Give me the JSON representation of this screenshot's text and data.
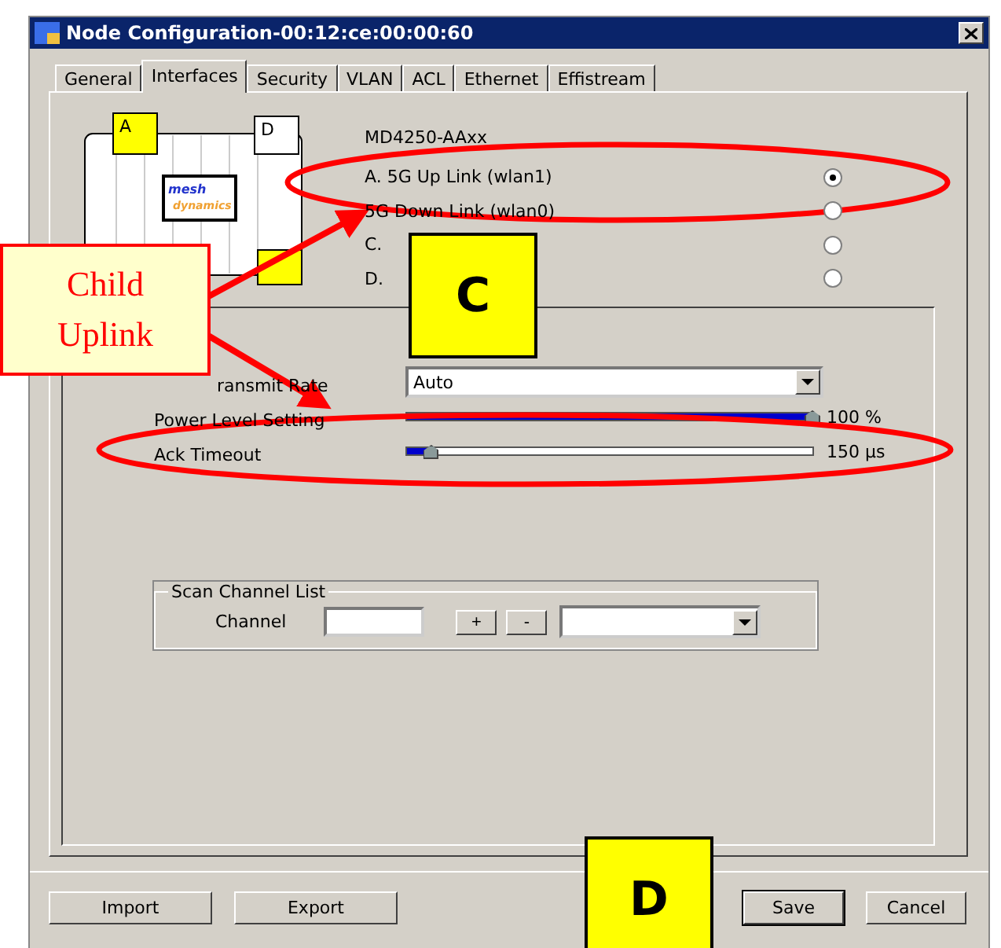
{
  "window": {
    "title": "Node Configuration-00:12:ce:00:00:60"
  },
  "tabs": [
    {
      "label": "General",
      "selected": false
    },
    {
      "label": "Interfaces",
      "selected": true
    },
    {
      "label": "Security",
      "selected": false
    },
    {
      "label": "VLAN",
      "selected": false
    },
    {
      "label": "ACL",
      "selected": false
    },
    {
      "label": "Ethernet",
      "selected": false
    },
    {
      "label": "Effistream",
      "selected": false
    }
  ],
  "device": {
    "ports": [
      {
        "label": "A",
        "color": "#ffff00"
      },
      {
        "label": "D",
        "color": "#ffffff"
      },
      {
        "color": "#ffff00"
      }
    ],
    "logo": [
      "mesh",
      "dynamics"
    ]
  },
  "model": "MD4250-AAxx",
  "interfaces": [
    {
      "label": "A. 5G  Up Link (wlan1)",
      "selected": true
    },
    {
      "label": "5G  Down Link (wlan0)",
      "selected": false
    },
    {
      "label": "C.",
      "selected": false
    },
    {
      "label": "D.",
      "selected": false
    }
  ],
  "settings": {
    "transmit_rate": {
      "label": "ransmit Rate",
      "value": "Auto"
    },
    "power_level": {
      "label": "Power Level Setting",
      "level": 1.0,
      "reading": "100 %"
    },
    "ack_timeout": {
      "label": "Ack Timeout",
      "level": 0.06,
      "reading": "150 µs"
    }
  },
  "scan_channel_list": {
    "title": "Scan Channel List",
    "channel_label": "Channel",
    "add": "+",
    "remove": "-"
  },
  "buttons": {
    "left": [
      "Import",
      "Export"
    ],
    "right": [
      "Save",
      "Cancel"
    ]
  },
  "annotations": {
    "callout": [
      "Child",
      "Uplink"
    ],
    "markers": [
      "C",
      "D"
    ]
  }
}
